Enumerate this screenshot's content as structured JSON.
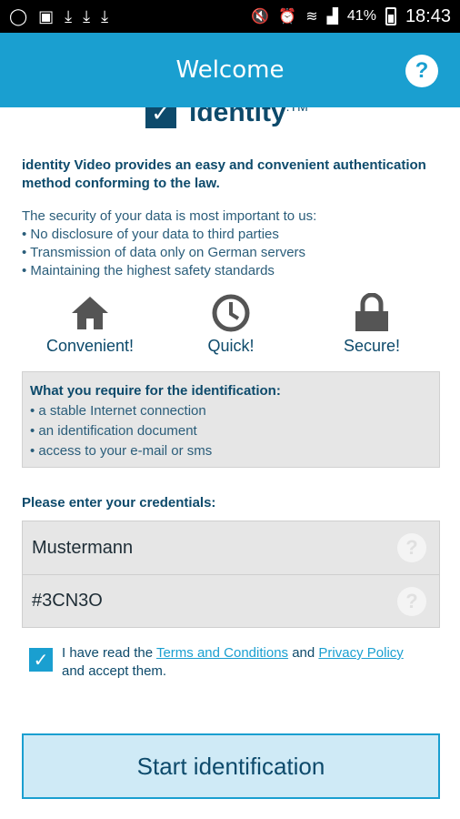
{
  "status_bar": {
    "icons": [
      "whatsapp-icon",
      "image-icon",
      "download-icon",
      "download-icon",
      "download-icon"
    ],
    "battery": "41%",
    "time": "18:43"
  },
  "header": {
    "title": "Welcome",
    "help_glyph": "?"
  },
  "logo": {
    "mark": "✓",
    "text": "identity",
    "suffix": ".TM"
  },
  "intro": "identity Video provides an easy and convenient authentication method conforming to the law.",
  "security": {
    "heading": "The security of your data is most important to us:",
    "items": [
      "No disclosure of your data to third parties",
      "Transmission of data only on German servers",
      "Maintaining the highest safety standards"
    ]
  },
  "features": [
    {
      "label": "Convenient!",
      "icon": "house-icon"
    },
    {
      "label": "Quick!",
      "icon": "clock-icon"
    },
    {
      "label": "Secure!",
      "icon": "lock-icon"
    }
  ],
  "requirements": {
    "title": "What you require for the identification:",
    "items": [
      "a stable Internet connection",
      "an identification document",
      "access to your e-mail or sms"
    ]
  },
  "credentials": {
    "label": "Please enter your credentials:",
    "name_value": "Mustermann",
    "code_value": "#3CN3O",
    "help_glyph": "?"
  },
  "terms": {
    "checked": true,
    "prefix": "I have read the ",
    "terms_link": "Terms and Conditions",
    "middle": " and ",
    "privacy_link": "Privacy Policy",
    "suffix": " and accept them."
  },
  "start_button": "Start identification",
  "colors": {
    "accent": "#1a9fd0",
    "text_dark": "#0d4a6b"
  }
}
